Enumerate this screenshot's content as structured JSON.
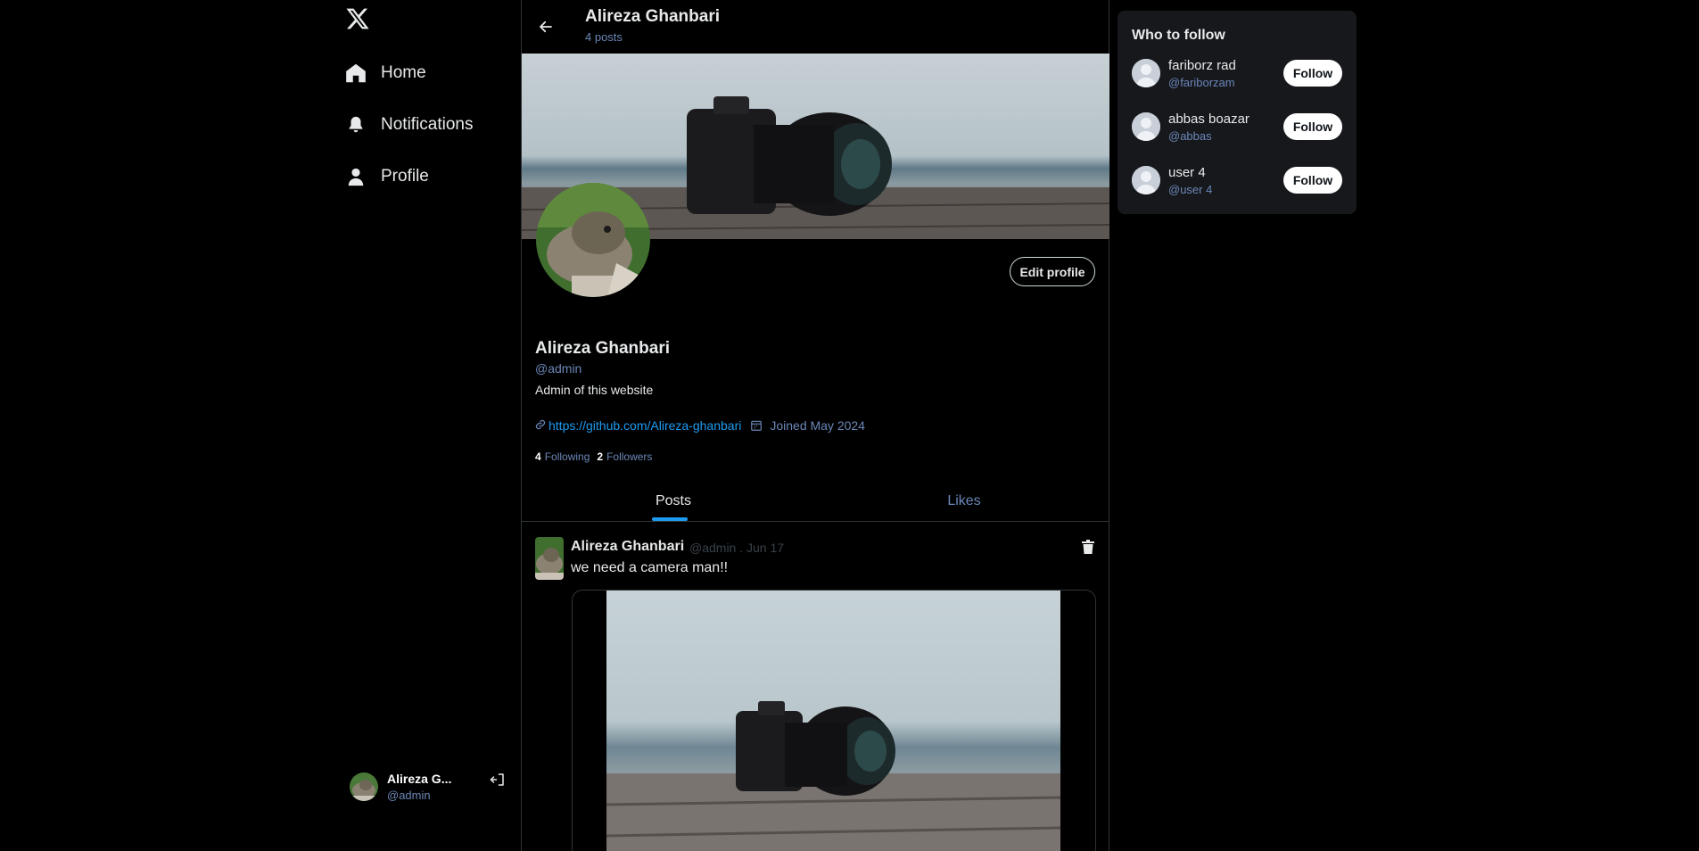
{
  "sidebar": {
    "logo": "x-logo-icon",
    "nav": [
      {
        "label": "Home",
        "icon": "home-icon"
      },
      {
        "label": "Notifications",
        "icon": "bell-icon"
      },
      {
        "label": "Profile",
        "icon": "user-icon"
      }
    ],
    "account": {
      "name": "Alireza G...",
      "handle": "@admin"
    }
  },
  "header": {
    "name": "Alireza Ghanbari",
    "post_count": "4 posts"
  },
  "profile": {
    "edit_label": "Edit profile",
    "name": "Alireza Ghanbari",
    "handle": "@admin",
    "bio": "Admin of this website",
    "link": "https://github.com/Alireza-ghanbari",
    "joined": "Joined May 2024",
    "following_count": "4",
    "following_label": "Following",
    "followers_count": "2",
    "followers_label": "Followers"
  },
  "tabs": [
    {
      "label": "Posts",
      "active": true
    },
    {
      "label": "Likes",
      "active": false
    }
  ],
  "post": {
    "author": "Alireza Ghanbari",
    "meta": "@admin . Jun 17",
    "text": "we need a camera man!!"
  },
  "who_to_follow": {
    "title": "Who to follow",
    "users": [
      {
        "name": "fariborz rad",
        "handle": "@fariborzam",
        "button": "Follow"
      },
      {
        "name": "abbas boazar",
        "handle": "@abbas",
        "button": "Follow"
      },
      {
        "name": "user 4",
        "handle": "@user 4",
        "button": "Follow"
      }
    ]
  },
  "colors": {
    "accent": "#1d9bf0",
    "handle": "#6b87b8",
    "background": "#000000",
    "panel": "#16181c"
  }
}
